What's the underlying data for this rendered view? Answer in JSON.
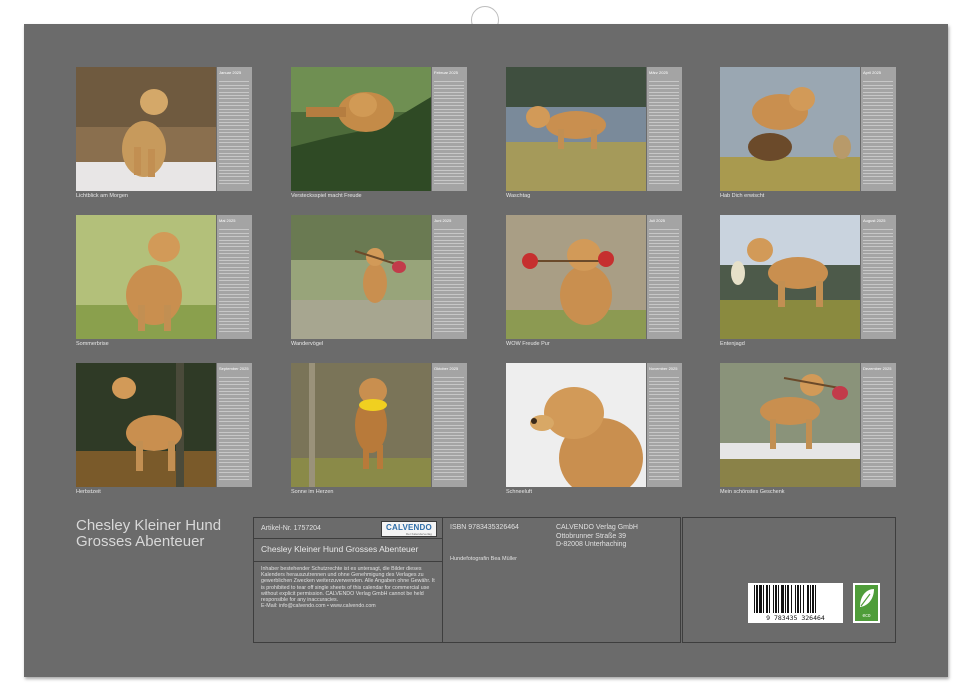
{
  "months": [
    {
      "name": "Januar 2025",
      "caption": "Lichtblick am Morgen"
    },
    {
      "name": "Februar 2025",
      "caption": "Verstecksspiel macht Freude"
    },
    {
      "name": "März 2025",
      "caption": "Waschtag"
    },
    {
      "name": "April 2025",
      "caption": "Hab Dich erwischt"
    },
    {
      "name": "Mai 2025",
      "caption": "Sommerbrise"
    },
    {
      "name": "Juni 2025",
      "caption": "Wandervögel"
    },
    {
      "name": "Juli 2025",
      "caption": "WOW Freude Pur"
    },
    {
      "name": "August 2025",
      "caption": "Entenjagd"
    },
    {
      "name": "September 2025",
      "caption": "Herbstzeit"
    },
    {
      "name": "Oktober 2025",
      "caption": "Sonne im Herzen"
    },
    {
      "name": "November 2025",
      "caption": "Schneeluft"
    },
    {
      "name": "Dezember 2025",
      "caption": "Mein schönstes Geschenk"
    }
  ],
  "title_line1": "Chesley Kleiner Hund",
  "title_line2": "Grosses Abenteuer",
  "article_no": "Artikel-Nr. 1757204",
  "logo_text": "CALVENDO",
  "logo_sub": "Der Kalenderverlag",
  "subtitle": "Chesley Kleiner Hund Grosses Abenteuer",
  "legal_text": "Inhaber bestehender Schutzrechte ist es untersagt, die Bilder dieses Kalenders herauszutrennen und ohne Genehmigung des Verlages zu gewerblichen Zwecken weiterzuverwenden. Alle Angaben ohne Gewähr. It is prohibited to tear off single sheets of this calendar for commercial use without explicit permission. CALVENDO Verlag GmbH cannot be held responsible for any inaccuracies.",
  "contact": "E-Mail: info@calvendo.com • www.calvendo.com",
  "isbn": "ISBN 9783435326464",
  "photographer": "Hundefotografin Bea Müller",
  "publisher": [
    "CALVENDO Verlag GmbH",
    "Ottobrunner Straße 39",
    "D-82008 Unterhaching"
  ],
  "barcode_number": "9 783435 326464",
  "eco_label": "eco"
}
